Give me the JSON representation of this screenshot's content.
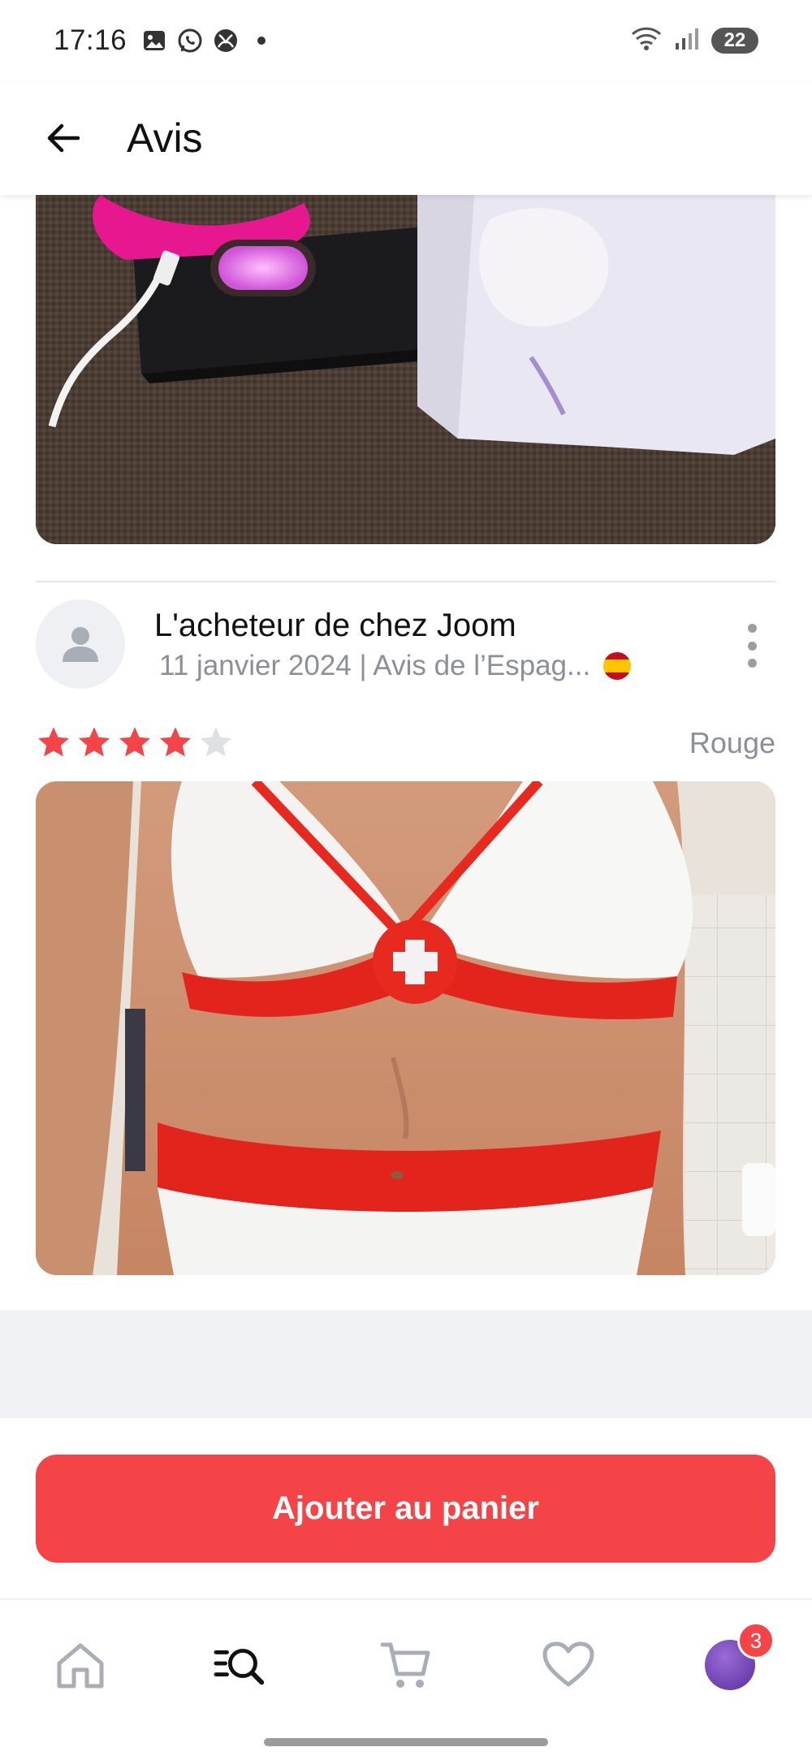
{
  "status_bar": {
    "time": "17:16",
    "battery": "22"
  },
  "header": {
    "title": "Avis"
  },
  "review": {
    "reviewer": "L'acheteur de chez Joom",
    "meta": "11 janvier 2024 | Avis de l’Espag...",
    "rating": 4,
    "rating_max": 5,
    "variant": "Rouge"
  },
  "cta": {
    "label": "Ajouter au panier"
  },
  "bottom_nav": {
    "profile_badge": "3"
  },
  "colors": {
    "accent": "#f44447",
    "star_empty": "#dfe0e4",
    "muted_text": "#8c8f97"
  },
  "icons": [
    "back-arrow-icon",
    "person-icon",
    "more-vertical-icon",
    "star-icon",
    "home-icon",
    "search-catalog-icon",
    "cart-icon",
    "heart-icon",
    "profile-avatar"
  ]
}
